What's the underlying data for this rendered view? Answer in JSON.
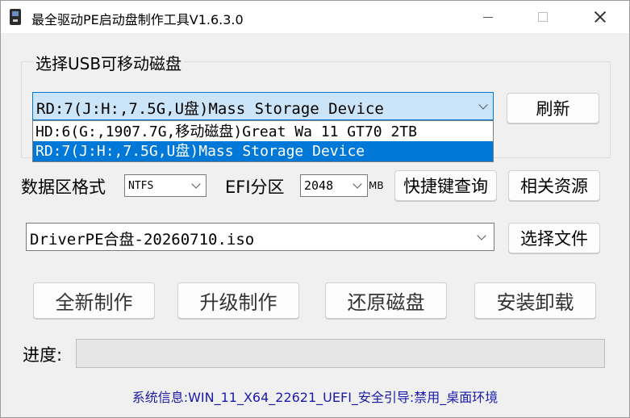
{
  "window": {
    "title": "最全驱动PE启动盘制作工具V1.6.3.0",
    "controls": {
      "minimize": "minimize-icon",
      "maximize": "maximize-icon",
      "close": "close-icon"
    }
  },
  "usb_group": {
    "title": "选择USB可移动磁盘",
    "selected_device": "RD:7(J:H:,7.5G,U盘)Mass Storage Device",
    "options": [
      "HD:6(G:,1907.7G,移动磁盘)Great Wa 11 GT70 2TB",
      "RD:7(J:H:,7.5G,U盘)Mass Storage Device"
    ],
    "refresh_label": "刷新"
  },
  "format_row": {
    "label": "数据区格式",
    "format_value": "NTFS",
    "efi_label": "EFI分区",
    "efi_value": "2048",
    "efi_unit": "MB",
    "shortcut_button": "快捷键查询",
    "resources_button": "相关资源"
  },
  "iso_row": {
    "iso_value": "DriverPE合盘-20260710.iso",
    "choose_file_button": "选择文件"
  },
  "actions": {
    "new_make": "全新制作",
    "upgrade_make": "升级制作",
    "restore_disk": "还原磁盘",
    "install_uninstall": "安装卸载"
  },
  "progress": {
    "label": "进度:",
    "value": 0
  },
  "system_info": "系统信息:WIN_11_X64_22621_UEFI_安全引导:禁用_桌面环境",
  "colors": {
    "selection": "#0078d7",
    "focused_combo": "#cce4f7",
    "sysinfo_text": "#1a1aa6"
  }
}
